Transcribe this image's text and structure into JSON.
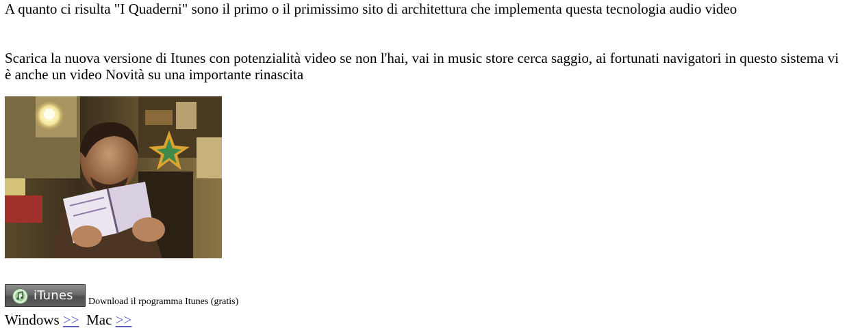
{
  "content": {
    "paragraph_1": "A quanto ci risulta \"I Quaderni\" sono il primo o il primissimo sito di architettura che implementa questa tecnologia audio video",
    "paragraph_2": "Scarica la nuova versione di Itunes con potenzialità video se non l'hai, vai in music store cerca saggio, ai fortunati navigatori in questo sistema vi è anche un video Novità su una importante rinascita"
  },
  "itunes": {
    "badge_label": "iTunes",
    "caption": "Download il rpogramma Itunes (gratis)"
  },
  "downloads": {
    "windows_label": "Windows",
    "windows_link": ">>",
    "mac_label": "Mac",
    "mac_link": ">>"
  },
  "colors": {
    "link": "#5a5fbf",
    "text": "#000000",
    "background": "#ffffff"
  }
}
